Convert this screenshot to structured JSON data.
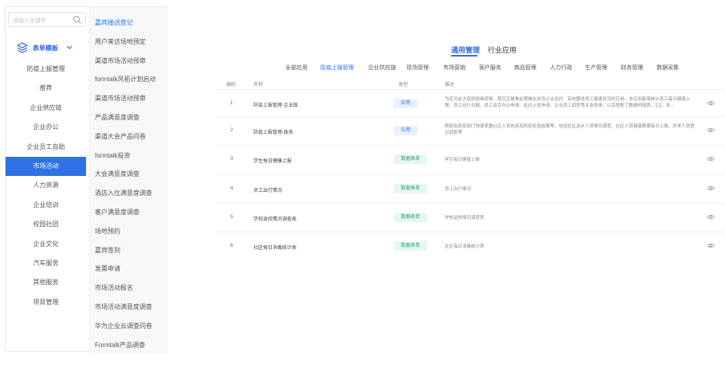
{
  "search": {
    "placeholder": "请输入关键字"
  },
  "categories": {
    "group_label": "表单模板",
    "items": [
      "防疫上报管理",
      "推荐",
      "企业供应链",
      "企业办公",
      "企业员工自助",
      "市场活动",
      "人力资源",
      "企业培训",
      "校园社团",
      "企业文化",
      "汽车服务",
      "其他服务",
      "项目管理"
    ],
    "active_index": 5
  },
  "forms": {
    "items": [
      "嘉宾接送登记",
      "用户来访场地预定",
      "渠道市场活动预审",
      "formtalk风拓计划启动",
      "渠道市场活动预审",
      "产品满意度调查",
      "渠道大会产品问卷",
      "formtalk投资",
      "大会满意度调查",
      "酒店入住满意度调查",
      "客户满意度调查",
      "场地预约",
      "嘉宾签到",
      "发票申请",
      "市场活动报名",
      "市场活动满意度调查",
      "华为企业云调查问卷",
      "Formtalk产品调查"
    ],
    "active_index": 0
  },
  "top_tabs": {
    "items": [
      "通用管理",
      "行业应用"
    ],
    "active_index": 0
  },
  "sub_tabs": {
    "items": [
      "全部应用",
      "防疫上报管理",
      "企业供应链",
      "现场管理",
      "市场营销",
      "客户服务",
      "商品管理",
      "人力行政",
      "生产管理",
      "财务管理",
      "数据采集"
    ],
    "active_index": 1
  },
  "table": {
    "headers": [
      "编码",
      "名称",
      "类型",
      "描述"
    ],
    "rows": [
      {
        "code": "1",
        "name": "防疫上报管理-企业版",
        "type": "应用",
        "type_kind": "app",
        "desc": "为应对此次冠状病毒疫情，我司正聚焦此期推出支持企业及时、有效跟进员工健康状况的应用，本应用能够统计员工每日健康上报、员工出行日报、员工返京办公申请、延迟上班申请、企业员工调查等五张表单，以及搭配了数据的报表。【注：本..."
      },
      {
        "code": "2",
        "name": "防疫上报管理-政务",
        "type": "应用",
        "type_kind": "app",
        "desc": "帮助各防疫部门快速掌握社区人员信息及防疫检查结果等，包括社区返乡人员情况调查、社区人员健康数据每日上报、外来人员登记调查等"
      },
      {
        "code": "3",
        "name": "学生每日健康上报",
        "type": "数据表单",
        "type_kind": "data",
        "desc": "学生每日健康上报"
      },
      {
        "code": "4",
        "name": "员工出行情况",
        "type": "数据表单",
        "type_kind": "data",
        "desc": "员工出行情况"
      },
      {
        "code": "5",
        "name": "学校返校情况调查表",
        "type": "数据表单",
        "type_kind": "data",
        "desc": "学校返校情况调查表"
      },
      {
        "code": "6",
        "name": "社区每日消毒统计表",
        "type": "数据表单",
        "type_kind": "data",
        "desc": "社区每日消毒统计表"
      }
    ]
  },
  "colors": {
    "accent": "#2e72e6",
    "tag_app_bg": "#e8f1ff",
    "tag_data_bg": "#e6f7f1",
    "tag_data_text": "#2ba07b"
  },
  "icons": {
    "search": "search-icon",
    "layers": "layers-icon",
    "chevron": "chevron-down-icon",
    "view": "eye-icon"
  }
}
